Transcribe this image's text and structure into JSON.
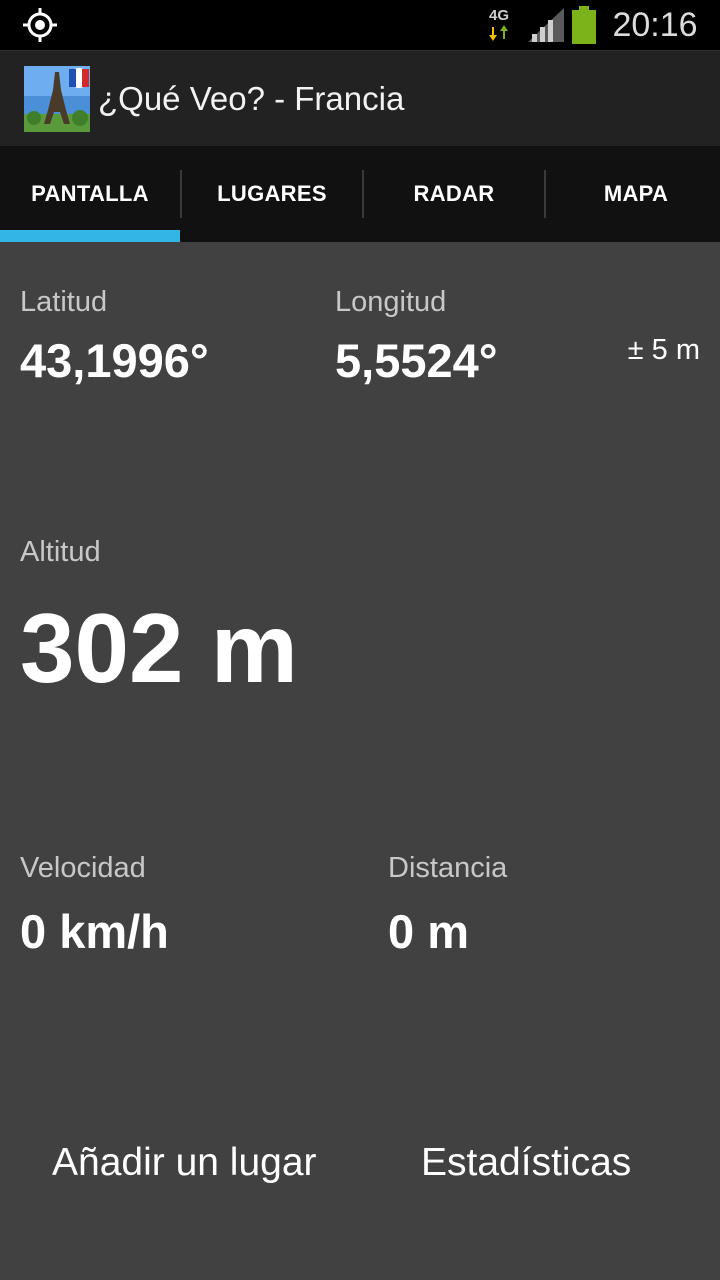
{
  "status_bar": {
    "icons": [
      "gps-icon",
      "network-4g-icon",
      "signal-icon",
      "battery-icon"
    ],
    "network_label": "4G",
    "time": "20:16",
    "battery_color": "#7cb31b"
  },
  "app": {
    "title": "¿Qué Veo? - Francia",
    "icon": "eiffel-tower-france-icon"
  },
  "tabs": [
    {
      "label": "PANTALLA",
      "selected": true
    },
    {
      "label": "LUGARES",
      "selected": false
    },
    {
      "label": "RADAR",
      "selected": false
    },
    {
      "label": "MAPA",
      "selected": false
    }
  ],
  "accent_color": "#33b5e5",
  "screen": {
    "latitude": {
      "label": "Latitud",
      "value": "43,1996°"
    },
    "longitude": {
      "label": "Longitud",
      "value": "5,5524°"
    },
    "accuracy": "± 5 m",
    "altitude": {
      "label": "Altitud",
      "value": "302 m"
    },
    "speed": {
      "label": "Velocidad",
      "value": "0 km/h"
    },
    "distance": {
      "label": "Distancia",
      "value": "0 m"
    },
    "actions": {
      "add_place": "Añadir un lugar",
      "statistics": "Estadísticas"
    }
  }
}
